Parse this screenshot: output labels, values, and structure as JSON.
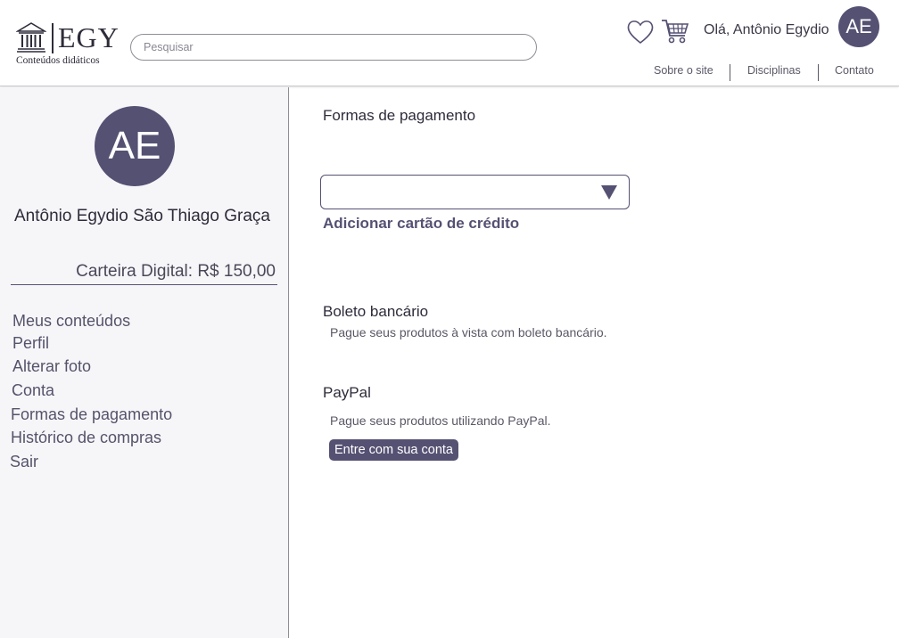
{
  "header": {
    "logo_text": "EGY",
    "logo_subtitle": "Conteúdos didáticos",
    "search_placeholder": "Pesquisar",
    "greeting": "Olá, Antônio Egydio",
    "avatar_initials": "AE",
    "nav": [
      "Sobre o site",
      "Disciplinas",
      "Contato"
    ],
    "icons": [
      "bank-logo-icon",
      "heart-icon",
      "cart-icon"
    ]
  },
  "sidebar": {
    "avatar_initials": "AE",
    "user_name": "Antônio Egydio São Thiago Graça",
    "wallet": "Carteira Digital: R$ 150,00",
    "menu": [
      "Meus conteúdos",
      "Perfil",
      "Alterar foto",
      "Conta",
      "Formas de pagamento",
      "Histórico de compras",
      "Sair"
    ]
  },
  "main": {
    "title": "Formas de pagamento",
    "select_value": "",
    "add_card_label": "Adicionar cartão de crédito",
    "boleto": {
      "title": "Boleto bancário",
      "description": "Pague seus produtos à vista com boleto bancário."
    },
    "paypal": {
      "title": "PayPal",
      "description": "Pague seus produtos utilizando PayPal.",
      "button_label": "Entre com sua conta"
    }
  },
  "colors": {
    "accent": "#555173",
    "sidebar_bg": "#f6f6f9",
    "text": "#2e2c3a"
  }
}
